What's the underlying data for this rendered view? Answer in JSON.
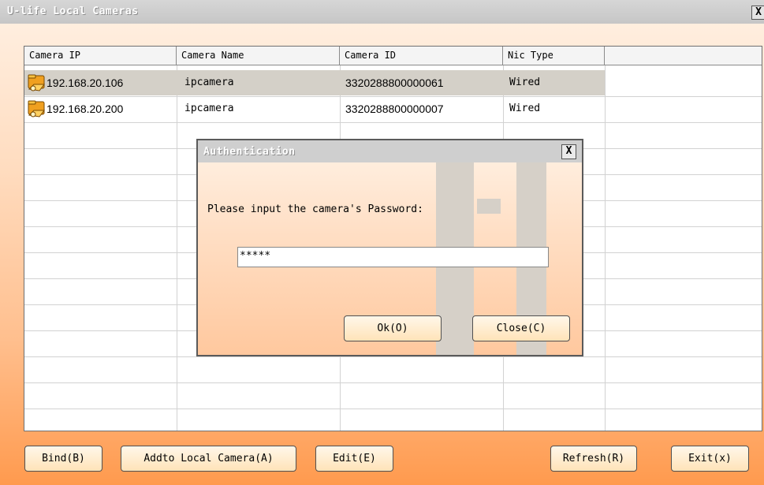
{
  "window": {
    "title": "U-life Local Cameras",
    "close_label": "X"
  },
  "table": {
    "columns": [
      "Camera IP",
      "Camera Name",
      "Camera ID",
      "Nic Type",
      ""
    ],
    "rows": [
      {
        "ip": "192.168.20.106",
        "name": "ipcamera",
        "id": "3320288800000061",
        "nic": "Wired",
        "selected": true
      },
      {
        "ip": "192.168.20.200",
        "name": "ipcamera",
        "id": "3320288800000007",
        "nic": "Wired",
        "selected": false
      }
    ],
    "row_icon": "camera-folder-icon"
  },
  "dialog": {
    "title": "Authentication",
    "close_label": "X",
    "prompt": "Please input the camera's Password:",
    "password_value": "*****",
    "ok_label": "Ok(O)",
    "close_button_label": "Close(C)"
  },
  "buttons": {
    "bind": "Bind(B)",
    "addto": "Addto Local Camera(A)",
    "edit": "Edit(E)",
    "refresh": "Refresh(R)",
    "exit": "Exit(x)"
  },
  "colors": {
    "accent": "#ff9a4e",
    "selection": "#d4d0c8"
  }
}
